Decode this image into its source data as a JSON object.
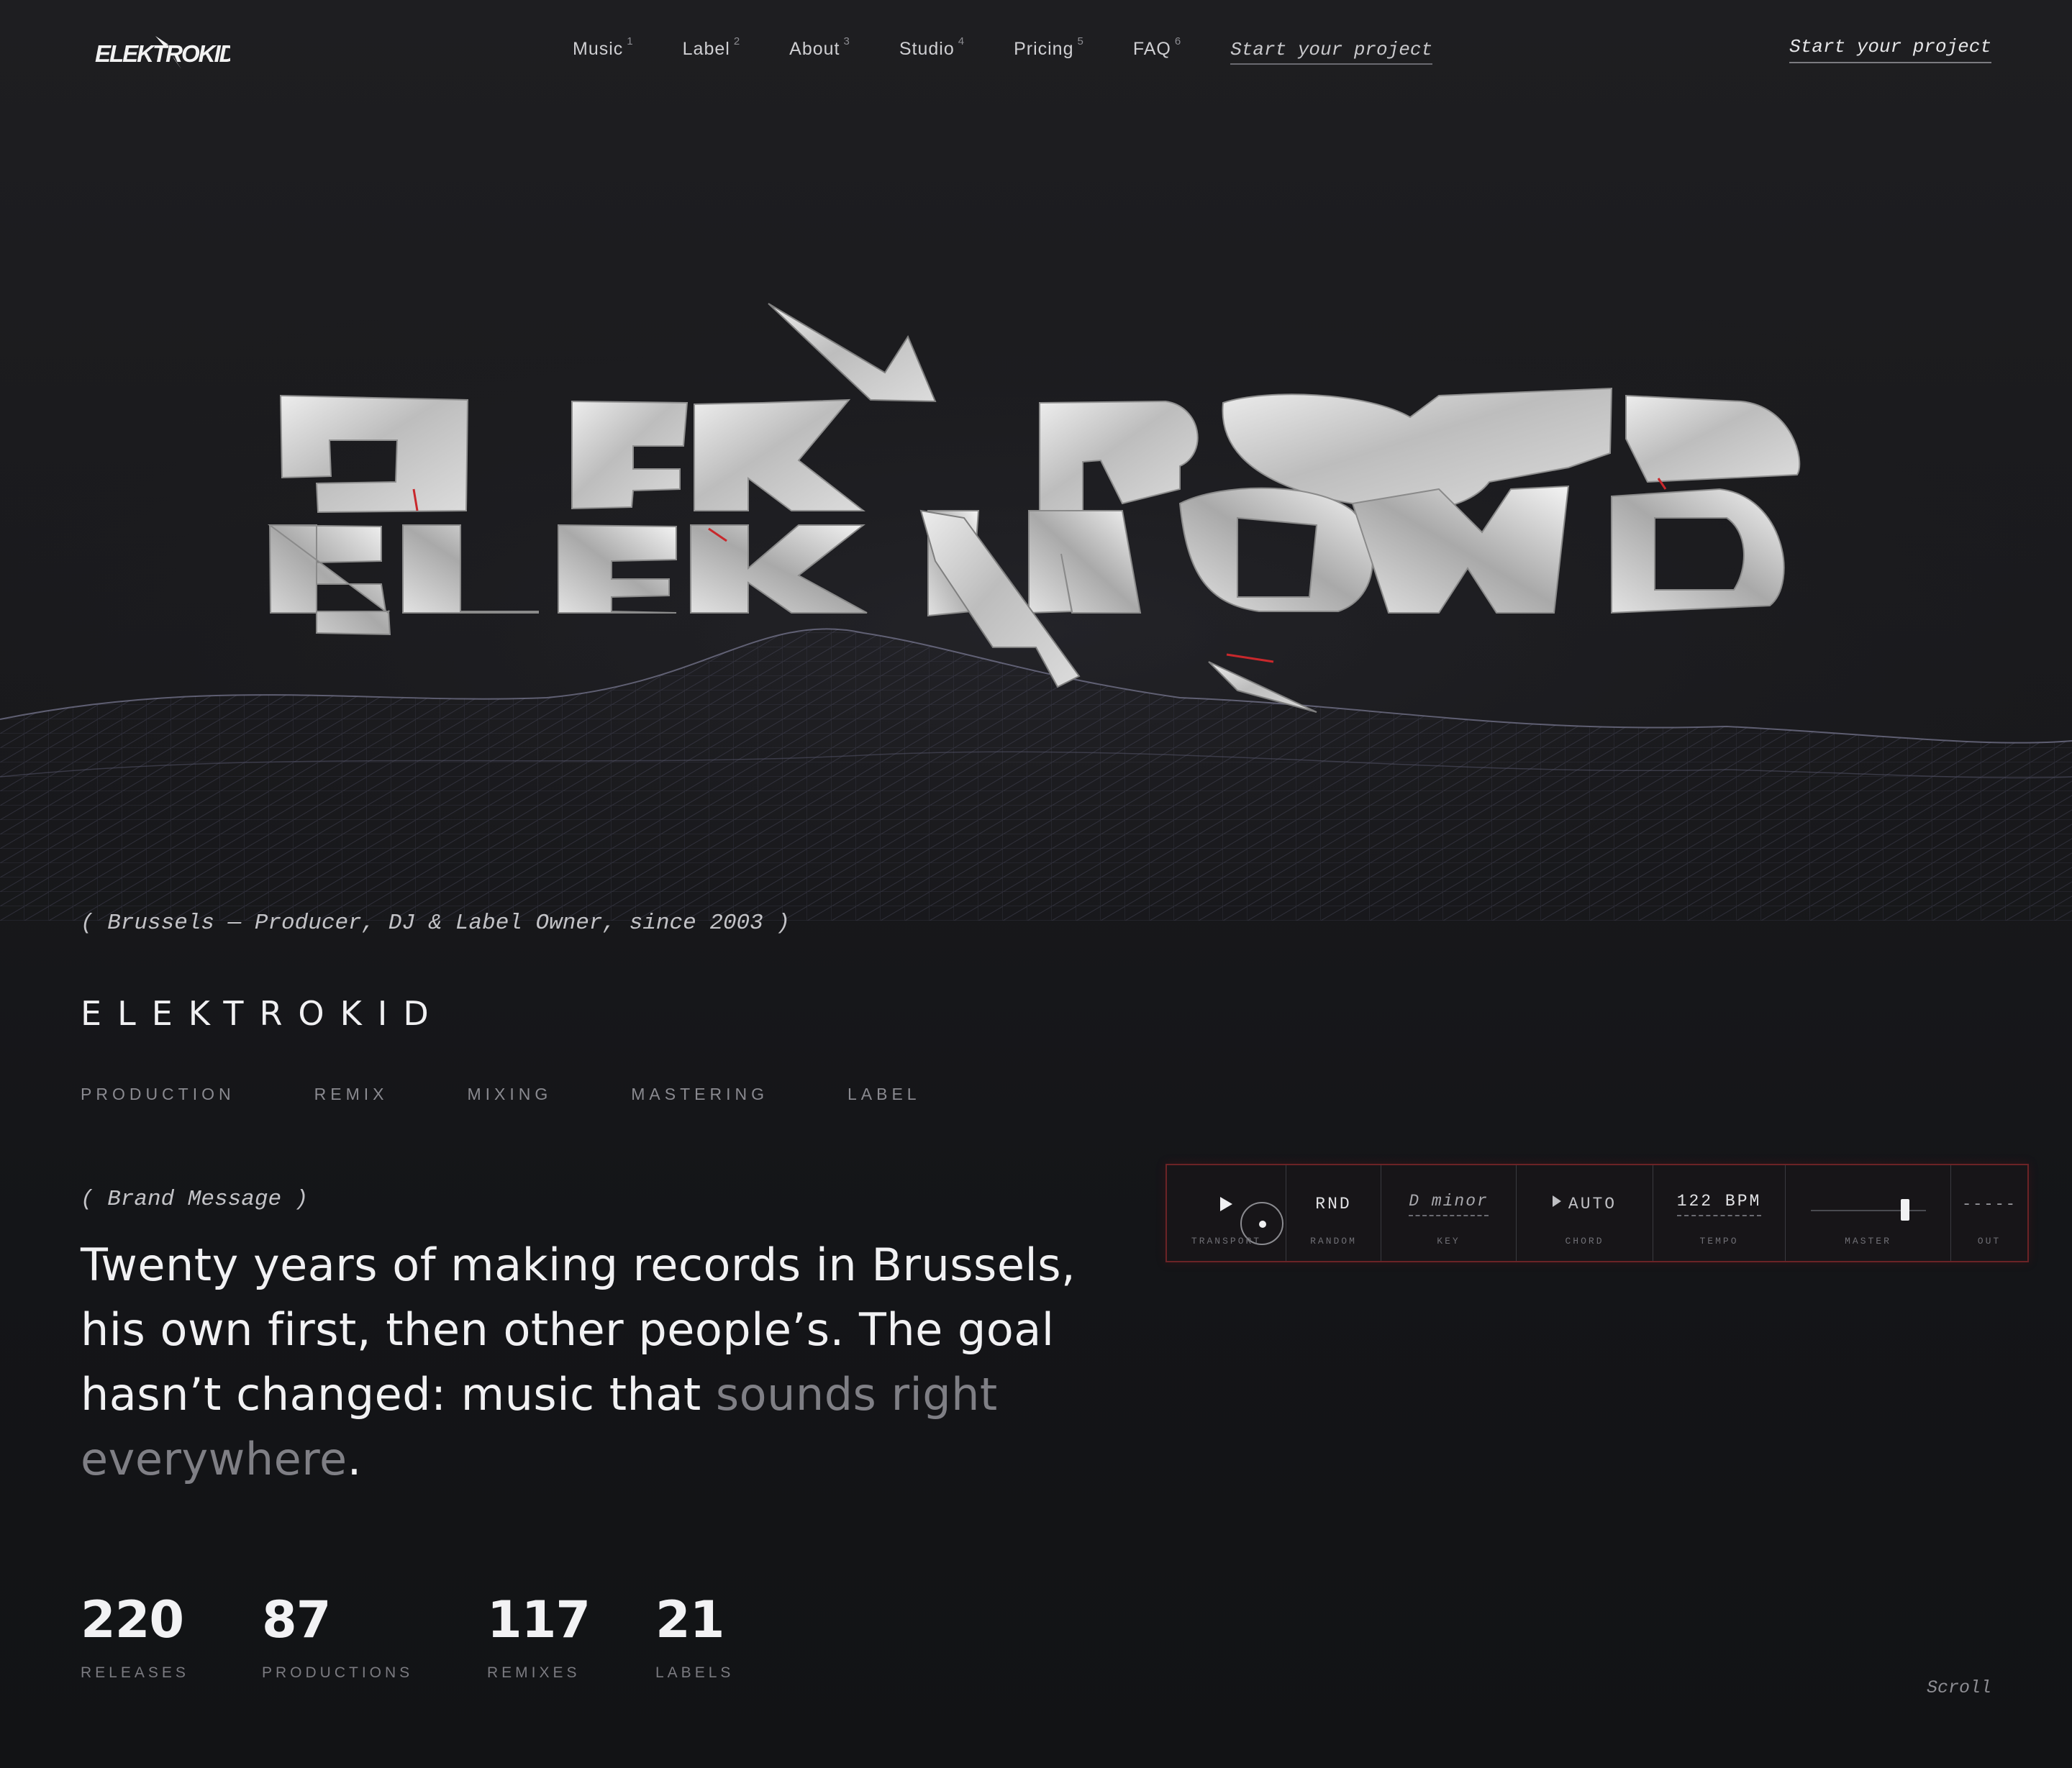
{
  "brand": {
    "logo_text": "ELEKTROKID"
  },
  "nav": {
    "items": [
      {
        "label": "Music",
        "num": "1"
      },
      {
        "label": "Label",
        "num": "2"
      },
      {
        "label": "About",
        "num": "3"
      },
      {
        "label": "Studio",
        "num": "4"
      },
      {
        "label": "Pricing",
        "num": "5"
      },
      {
        "label": "FAQ",
        "num": "6"
      }
    ],
    "cta": "Start your project"
  },
  "header_cta": "Start your project",
  "hero": {
    "wordmark": "ELEKTROKID",
    "colors": {
      "metal": "#cfcfcf",
      "accent": "#c8282c",
      "wire": "#8a8aa0"
    }
  },
  "intro": {
    "tagline": "( Brussels — Producer, DJ & Label Owner, since 2003 )",
    "name": "ELEKTROKID",
    "services": [
      "PRODUCTION",
      "REMIX",
      "MIXING",
      "MASTERING",
      "LABEL"
    ]
  },
  "brand_message": {
    "label": "( Brand Message )",
    "text_main": "Twenty years of making records in Brussels, his own first, then other people’s. The goal hasn’t changed: music that ",
    "text_dim": "sounds right everywhere",
    "text_end": "."
  },
  "synth": {
    "transport": {
      "caption": "TRANSPORT",
      "icon": "play-icon"
    },
    "random": {
      "value": "RND",
      "caption": "RANDOM"
    },
    "key": {
      "value": "D minor",
      "caption": "KEY"
    },
    "chord": {
      "value": "AUTO",
      "caption": "CHORD"
    },
    "tempo": {
      "value": "122 BPM",
      "caption": "TEMPO"
    },
    "master": {
      "caption": "MASTER",
      "level": 0.85
    },
    "out": {
      "value": "-----",
      "caption": "OUT"
    },
    "accent": "#6b2326"
  },
  "stats": [
    {
      "value": "220",
      "label": "RELEASES"
    },
    {
      "value": "87",
      "label": "PRODUCTIONS"
    },
    {
      "value": "117",
      "label": "REMIXES"
    },
    {
      "value": "21",
      "label": "LABELS"
    }
  ],
  "scroll_hint": "Scroll"
}
